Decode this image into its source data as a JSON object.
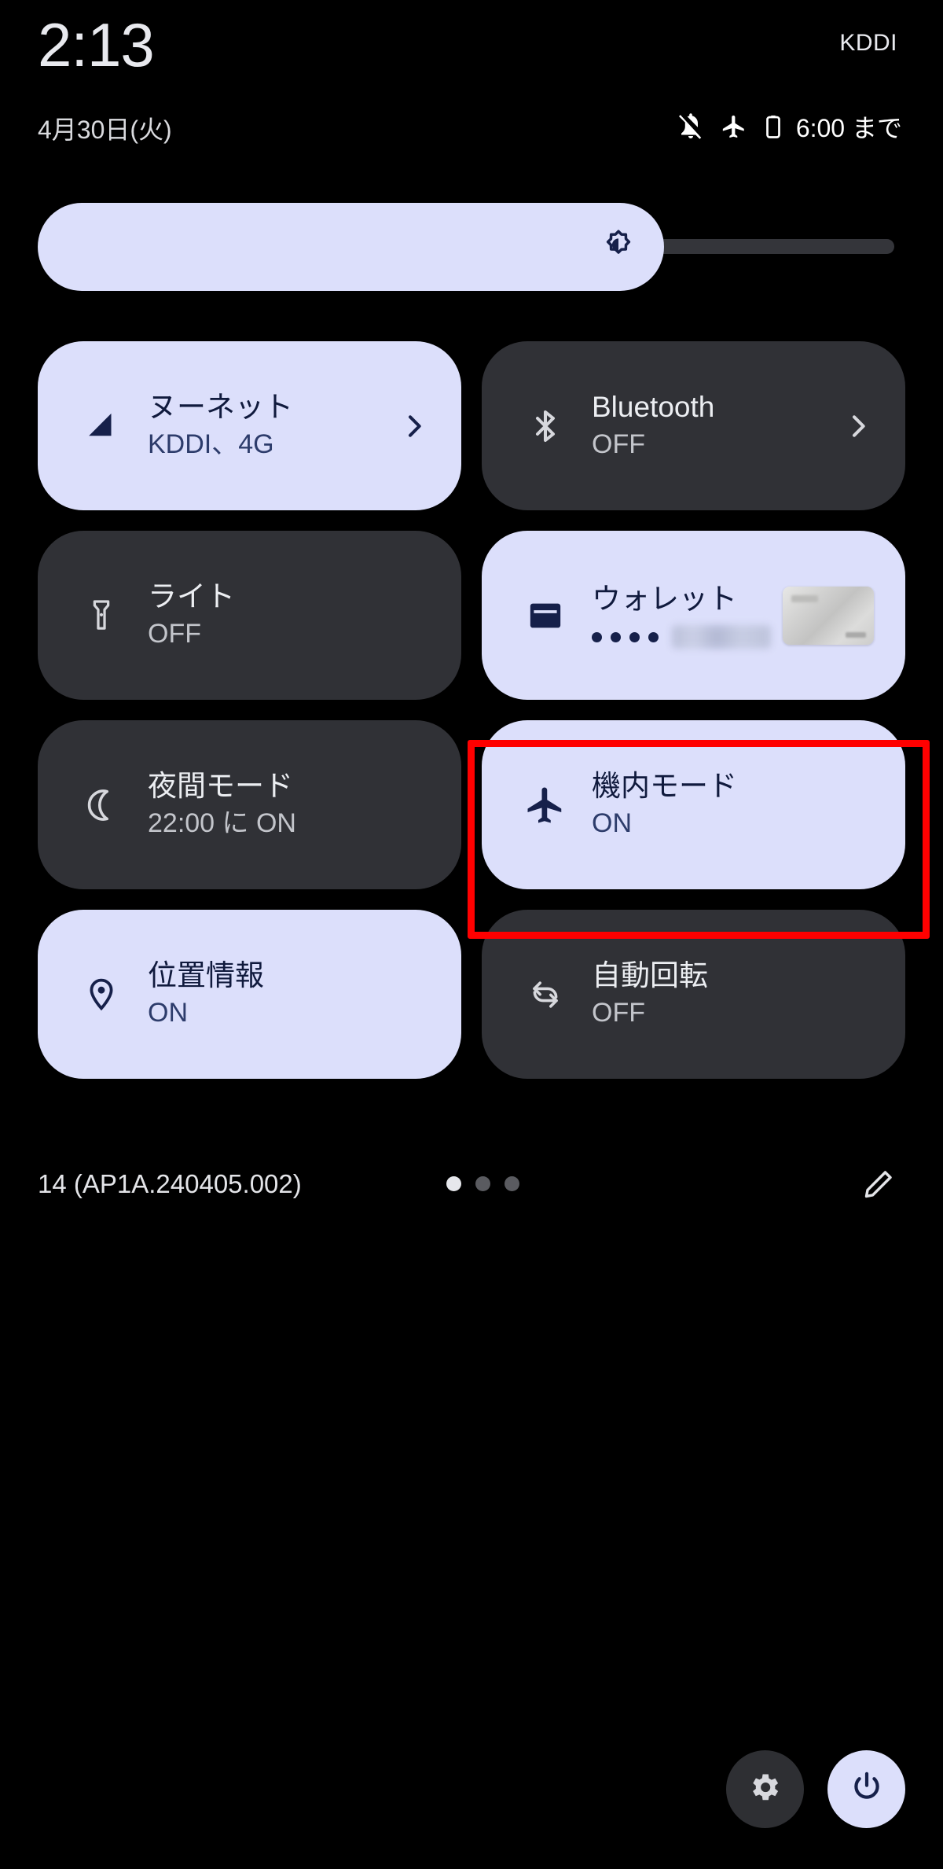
{
  "statusbar": {
    "time": "2:13",
    "carrier": "KDDI",
    "date": "4月30日(火)",
    "battery_text": "6:00 まで",
    "icons": [
      "mute-icon",
      "airplane-icon",
      "battery-icon"
    ]
  },
  "brightness": {
    "name": "brightness-slider",
    "icon": "brightness-icon",
    "level_percent": 72
  },
  "tiles": [
    {
      "id": "internet",
      "icon": "signal-cellular-icon",
      "title": "ヌーネット",
      "subtitle": "KDDI、4G",
      "state": "on",
      "has_chevron": true
    },
    {
      "id": "bluetooth",
      "icon": "bluetooth-icon",
      "title": "Bluetooth",
      "subtitle": "OFF",
      "state": "off",
      "has_chevron": true
    },
    {
      "id": "flashlight",
      "icon": "flashlight-icon",
      "title": "ライト",
      "subtitle": "OFF",
      "state": "off",
      "has_chevron": false
    },
    {
      "id": "wallet",
      "icon": "wallet-icon",
      "title": "ウォレット",
      "subtitle": "",
      "state": "on",
      "has_chevron": false,
      "masked_digits": "••••",
      "card_thumbnail": "credit-card-thumbnail"
    },
    {
      "id": "night-mode",
      "icon": "moon-icon",
      "title": "夜間モード",
      "subtitle": "22:00 に ON",
      "state": "off",
      "has_chevron": false
    },
    {
      "id": "airplane-mode",
      "icon": "airplane-icon",
      "title": "機内モード",
      "subtitle": "ON",
      "state": "on",
      "has_chevron": false,
      "highlighted": true
    },
    {
      "id": "location",
      "icon": "location-pin-icon",
      "title": "位置情報",
      "subtitle": "ON",
      "state": "on",
      "has_chevron": false
    },
    {
      "id": "auto-rotate",
      "icon": "auto-rotate-icon",
      "title": "自動回転",
      "subtitle": "OFF",
      "state": "off",
      "has_chevron": false
    }
  ],
  "footer": {
    "build": "14 (AP1A.240405.002)",
    "page_dots": 3,
    "active_dot": 0,
    "edit_icon": "pencil-edit-icon"
  },
  "bottom": {
    "settings_icon": "gear-icon",
    "power_icon": "power-icon"
  },
  "annotation": {
    "color": "#ff0000",
    "target": "airplane-mode"
  },
  "colors": {
    "background": "#000000",
    "tile_on": "#dcdffb",
    "tile_off": "#303136",
    "text_on": "#101a3d",
    "text_off": "#eceef2",
    "accent_red": "#ff0000"
  }
}
